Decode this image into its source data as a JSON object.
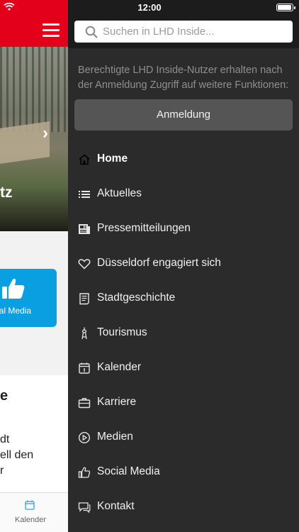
{
  "status": {
    "time": "12:00"
  },
  "background_app": {
    "hero_title_fragment": "tz",
    "social_label_fragment": "cial Media",
    "card_title_fragment": "e",
    "card_lines": [
      "dt",
      "ell den",
      "r"
    ],
    "tab_label": "Kalender"
  },
  "drawer": {
    "search": {
      "placeholder": "Suchen in LHD Inside..."
    },
    "info_text": "Berechtigte LHD Inside-Nutzer erhalten nach der Anmeldung Zugriff auf weitere Funktionen:",
    "login_label": "Anmeldung",
    "menu": [
      {
        "label": "Home",
        "icon": "home-icon",
        "active": true
      },
      {
        "label": "Aktuelles",
        "icon": "list-icon"
      },
      {
        "label": "Pressemitteilungen",
        "icon": "newspaper-icon"
      },
      {
        "label": "Düsseldorf engagiert sich",
        "icon": "heart-icon"
      },
      {
        "label": "Stadtgeschichte",
        "icon": "scroll-icon"
      },
      {
        "label": "Tourismus",
        "icon": "tower-icon"
      },
      {
        "label": "Kalender",
        "icon": "calendar-icon"
      },
      {
        "label": "Karriere",
        "icon": "briefcase-icon"
      },
      {
        "label": "Medien",
        "icon": "play-icon"
      },
      {
        "label": "Social Media",
        "icon": "thumbs-up-icon"
      },
      {
        "label": "Kontakt",
        "icon": "chat-icon"
      }
    ]
  },
  "colors": {
    "brand_red": "#e3001b",
    "drawer_bg": "#2b2b2b",
    "social_blue": "#0a9fe0"
  }
}
